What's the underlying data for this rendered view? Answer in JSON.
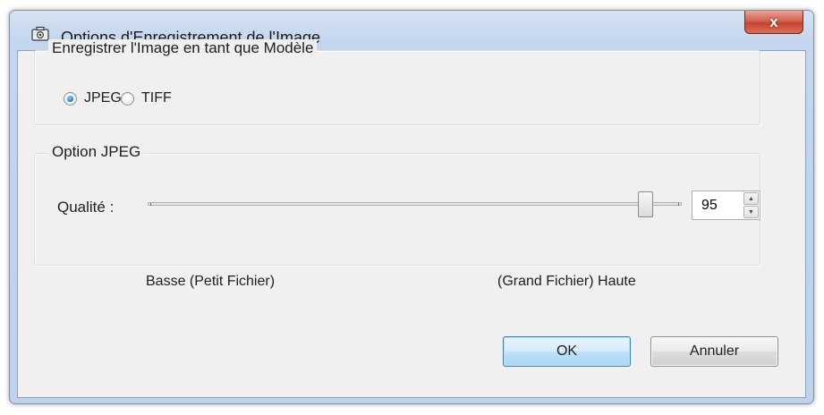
{
  "window": {
    "title": "Options d'Enregistrement de l'Image",
    "title_icon": "camera-icon",
    "close_label": "x"
  },
  "format_group": {
    "legend": "Enregistrer l'Image en tant que Modèle",
    "options": [
      {
        "label": "JPEG",
        "selected": true
      },
      {
        "label": "TIFF",
        "selected": false
      }
    ]
  },
  "jpeg_group": {
    "legend": "Option JPEG",
    "quality_label": "Qualité :",
    "quality_value": "95",
    "slider_level": 95,
    "low_label": "Basse (Petit Fichier)",
    "high_label": "(Grand Fichier) Haute"
  },
  "buttons": {
    "ok": "OK",
    "cancel": "Annuler"
  },
  "colors": {
    "accent": "#3c7fb1",
    "close": "#c5432d"
  }
}
